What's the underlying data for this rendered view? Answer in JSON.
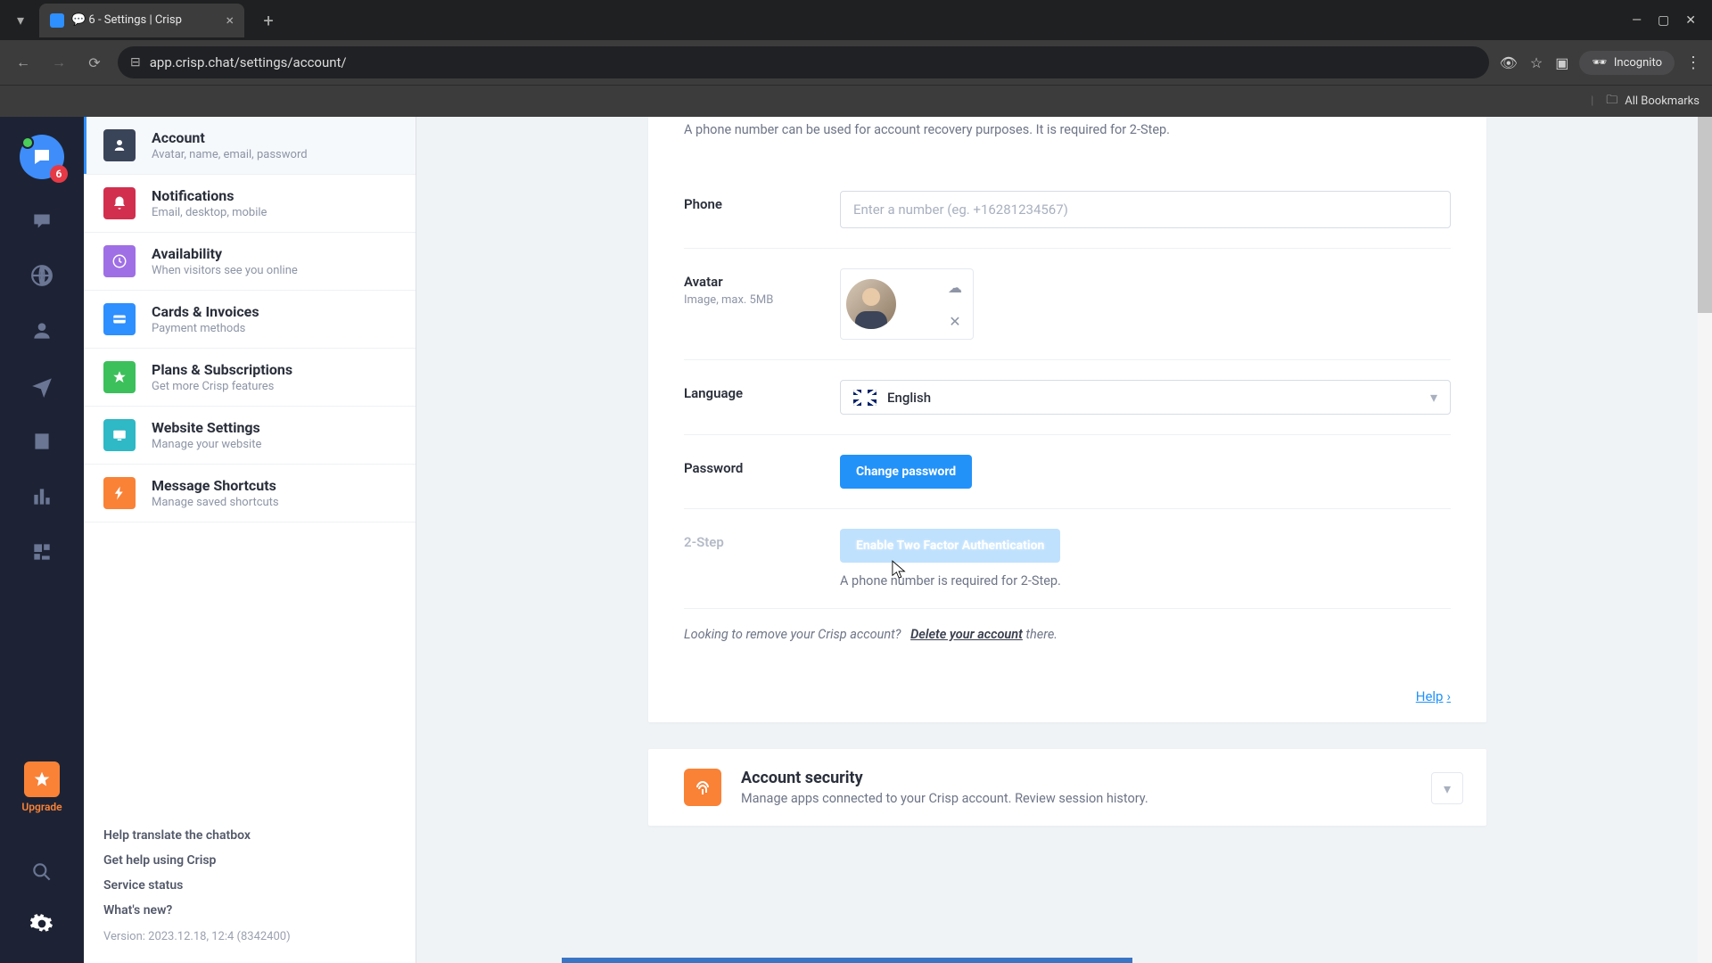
{
  "browser": {
    "tab_title": "💬 6 - Settings | Crisp",
    "url": "app.crisp.chat/settings/account/",
    "incognito_label": "Incognito",
    "bookmarks_label": "All Bookmarks"
  },
  "rail": {
    "badge": "6",
    "upgrade_label": "Upgrade"
  },
  "sidebar": {
    "items": [
      {
        "label": "Account",
        "sub": "Avatar, name, email, password",
        "color": "#3a4459",
        "icon": "user"
      },
      {
        "label": "Notifications",
        "sub": "Email, desktop, mobile",
        "color": "#d22f4e",
        "icon": "bell"
      },
      {
        "label": "Availability",
        "sub": "When visitors see you online",
        "color": "#9f6fe6",
        "icon": "clock"
      },
      {
        "label": "Cards & Invoices",
        "sub": "Payment methods",
        "color": "#2e8fff",
        "icon": "card"
      },
      {
        "label": "Plans & Subscriptions",
        "sub": "Get more Crisp features",
        "color": "#3cc05b",
        "icon": "star"
      },
      {
        "label": "Website Settings",
        "sub": "Manage your website",
        "color": "#2fb8c5",
        "icon": "monitor"
      },
      {
        "label": "Message Shortcuts",
        "sub": "Manage saved shortcuts",
        "color": "#f98237",
        "icon": "bolt"
      }
    ],
    "footer": {
      "translate": "Help translate the chatbox",
      "help": "Get help using Crisp",
      "status": "Service status",
      "new": "What's new?",
      "version": "Version: 2023.12.18, 12:4 (8342400)"
    }
  },
  "account": {
    "phone_description": "A phone number can be used for account recovery purposes. It is required for 2-Step.",
    "phone_label": "Phone",
    "phone_placeholder": "Enter a number (eg. +16281234567)",
    "phone_value": "",
    "avatar_label": "Avatar",
    "avatar_sub": "Image, max. 5MB",
    "language_label": "Language",
    "language_value": "English",
    "password_label": "Password",
    "change_password_btn": "Change password",
    "twostep_label": "2-Step",
    "twostep_btn": "Enable Two Factor Authentication",
    "twostep_note": "A phone number is required for 2-Step.",
    "delete_prompt": "Looking to remove your Crisp account?",
    "delete_link": "Delete your account",
    "delete_suffix": " there.",
    "help_label": "Help"
  },
  "security": {
    "title": "Account security",
    "sub": "Manage apps connected to your Crisp account. Review session history."
  }
}
